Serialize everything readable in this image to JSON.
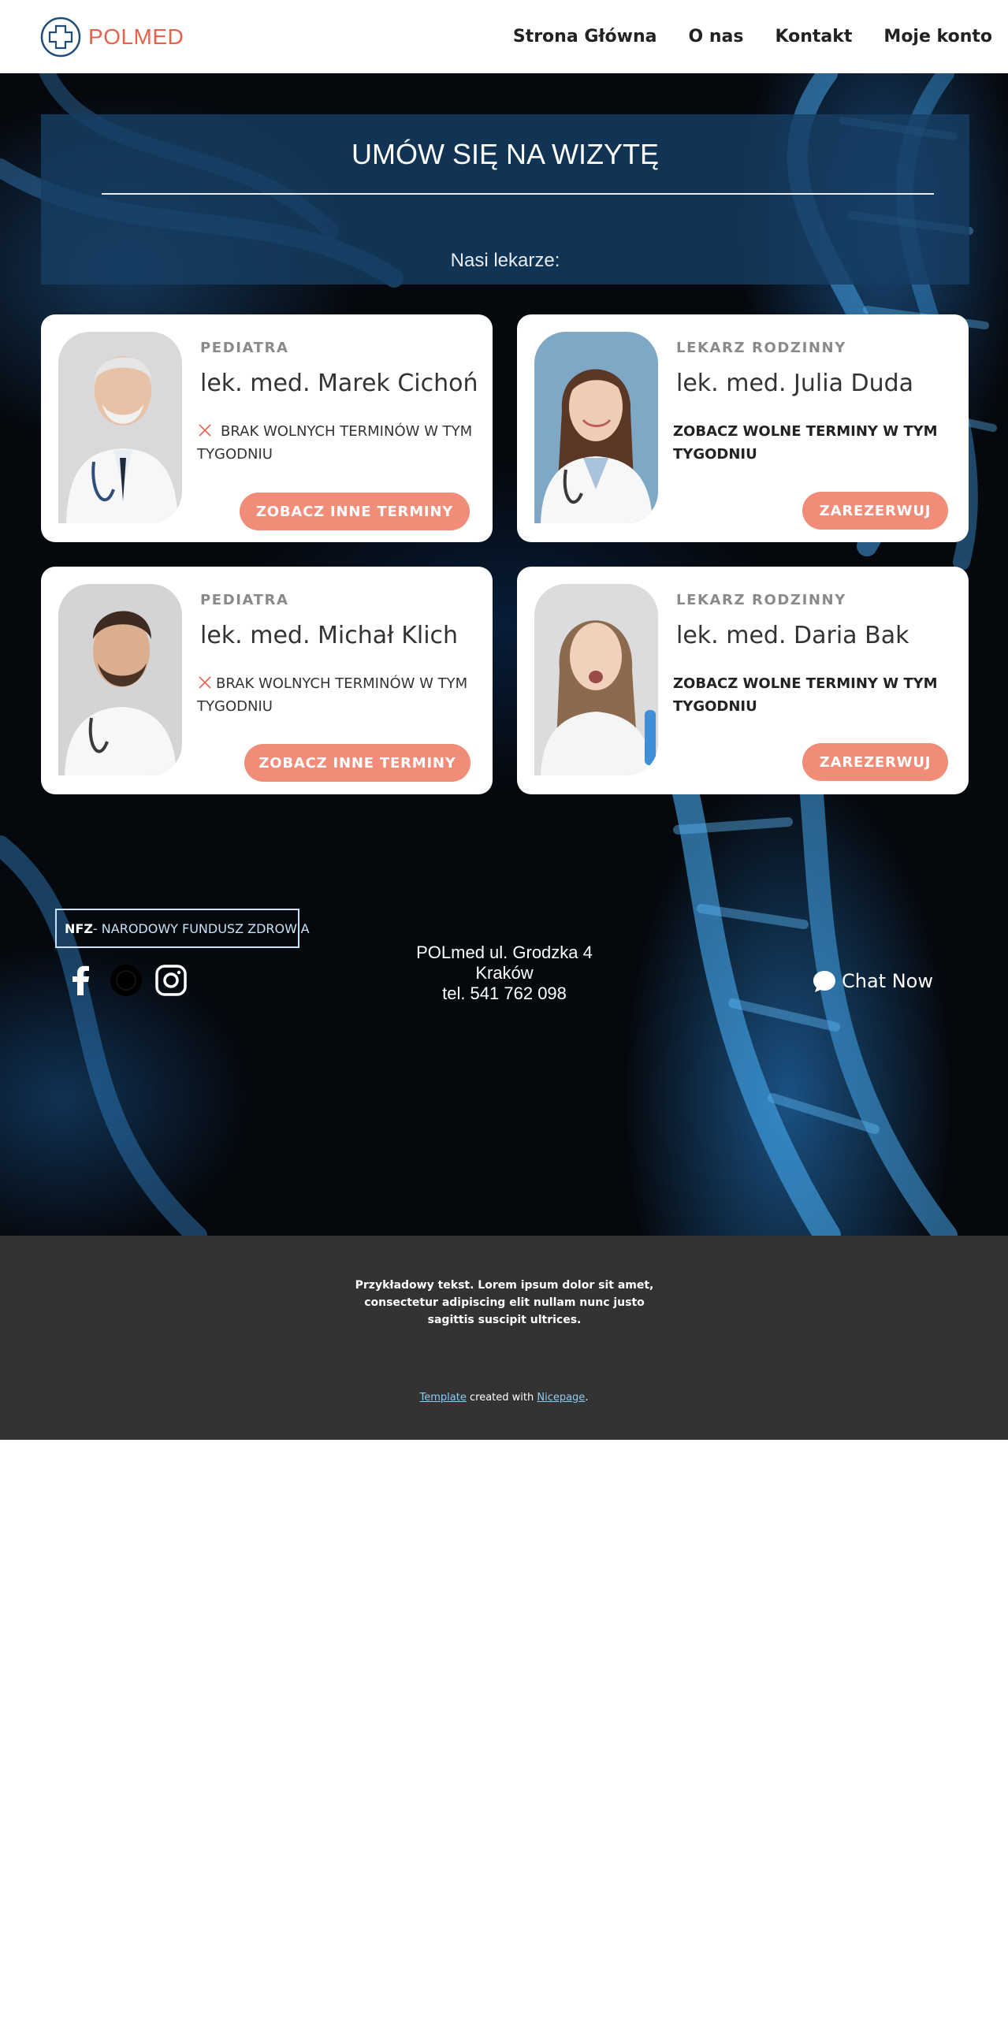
{
  "brand": {
    "name": "POLMED"
  },
  "nav": {
    "items": [
      "Strona Główna",
      "O nas",
      "Kontakt",
      "Moje konto"
    ]
  },
  "banner": {
    "title": "UMÓW SIĘ NA WIZYTĘ",
    "subtitle": "Nasi lekarze:"
  },
  "doctors": [
    {
      "specialty": "PEDIATRA",
      "name": "lek. med. Marek Cichoń",
      "status": "BRAK WOLNYCH TERMINÓW W TYM TYGODNIU",
      "button": "ZOBACZ INNE TERMINY"
    },
    {
      "specialty": "LEKARZ RODZINNY",
      "name": "lek. med. Julia Duda",
      "status": "ZOBACZ WOLNE TERMINY W TYM TYGODNIU",
      "button": "ZAREZERWUJ"
    },
    {
      "specialty": "PEDIATRA",
      "name": "lek. med. Michał Klich",
      "status": "BRAK WOLNYCH TERMINÓW W TYM TYGODNIU",
      "button": "ZOBACZ INNE TERMINY"
    },
    {
      "specialty": "LEKARZ RODZINNY",
      "name": "lek. med. Daria Bak",
      "status": "ZOBACZ WOLNE TERMINY W TYM TYGODNIU",
      "button": "ZAREZERWUJ"
    }
  ],
  "info": {
    "nfz_short": "NFZ",
    "nfz_full": "- NARODOWY FUNDUSZ ZDROWIA",
    "address_line1": "POLmed ul. Grodzka 4",
    "address_line2": "Kraków",
    "phone": "tel. 541 762 098",
    "chat": "Chat Now",
    "social": [
      "facebook-icon",
      "globe-icon",
      "instagram-icon"
    ]
  },
  "footer": {
    "text": "Przykładowy tekst. Lorem ipsum dolor sit amet, consectetur adipiscing elit nullam nunc justo sagittis suscipit ultrices.",
    "template_link": "Template",
    "created_with": " created with ",
    "nicepage_link": "Nicepage",
    "period": "."
  },
  "colors": {
    "accent": "#f18c78",
    "brand": "#e8614a",
    "banner": "#163e64",
    "footer": "#333333"
  }
}
